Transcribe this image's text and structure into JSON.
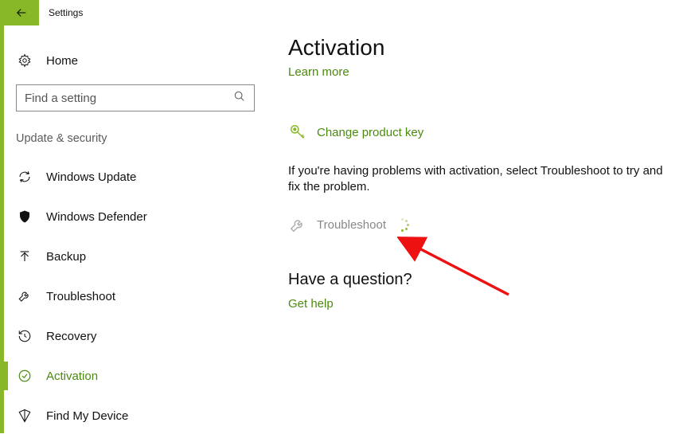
{
  "titlebar": {
    "title": "Settings"
  },
  "sidebar": {
    "home_label": "Home",
    "search_placeholder": "Find a setting",
    "category": "Update & security",
    "items": [
      {
        "label": "Windows Update"
      },
      {
        "label": "Windows Defender"
      },
      {
        "label": "Backup"
      },
      {
        "label": "Troubleshoot"
      },
      {
        "label": "Recovery"
      },
      {
        "label": "Activation"
      },
      {
        "label": "Find My Device"
      }
    ]
  },
  "main": {
    "title": "Activation",
    "learn_more": "Learn more",
    "change_key": "Change product key",
    "trouble_text": "If you're having problems with activation, select Troubleshoot to try and fix the problem.",
    "troubleshoot": "Troubleshoot",
    "question": "Have a question?",
    "get_help": "Get help"
  }
}
